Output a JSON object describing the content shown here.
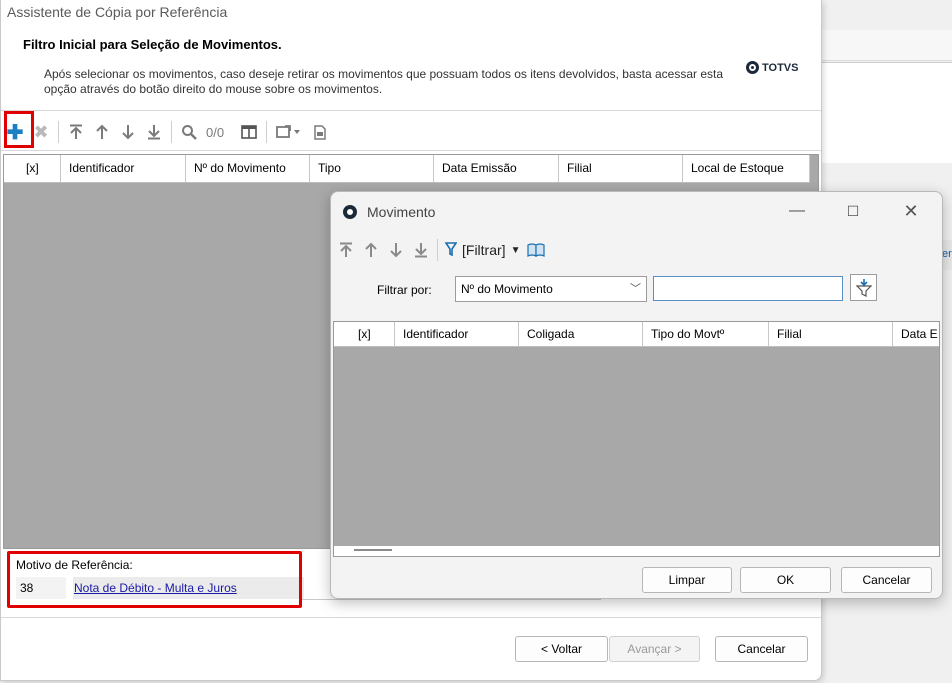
{
  "wizard": {
    "title": "Assistente de Cópia por Referência",
    "heading": "Filtro Inicial para Seleção de Movimentos.",
    "description": "Após selecionar os movimentos, caso deseje retirar os movimentos que possuam todos os itens devolvidos, basta acessar esta opção através do botão direito do mouse sobre os movimentos.",
    "brand": "TOTVS",
    "record_count": "0/0",
    "columns": [
      "[x]",
      "Identificador",
      "Nº do Movimento",
      "Tipo",
      "Data Emissão",
      "Filial",
      "Local de Estoque"
    ],
    "motivo": {
      "label": "Motivo de Referência:",
      "code": "38",
      "description": "Nota de Débito - Multa e Juros"
    },
    "buttons": {
      "back": "< Voltar",
      "next": "Avançar >",
      "cancel": "Cancelar"
    }
  },
  "dialog": {
    "title": "Movimento",
    "filter_button": "[Filtrar]",
    "filter_label": "Filtrar por:",
    "filter_field": "Nº do Movimento",
    "filter_value": "",
    "columns": [
      "[x]",
      "Identificador",
      "Coligada",
      "Tipo do Movtº",
      "Filial",
      "Data E"
    ],
    "buttons": {
      "clear": "Limpar",
      "ok": "OK",
      "cancel": "Cancelar"
    }
  },
  "background": {
    "partial_text": "er"
  },
  "colors": {
    "highlight": "#e00000",
    "accent": "#1b7fc3",
    "grid_bg": "#a8a8a8",
    "link": "#1a1aa6"
  }
}
